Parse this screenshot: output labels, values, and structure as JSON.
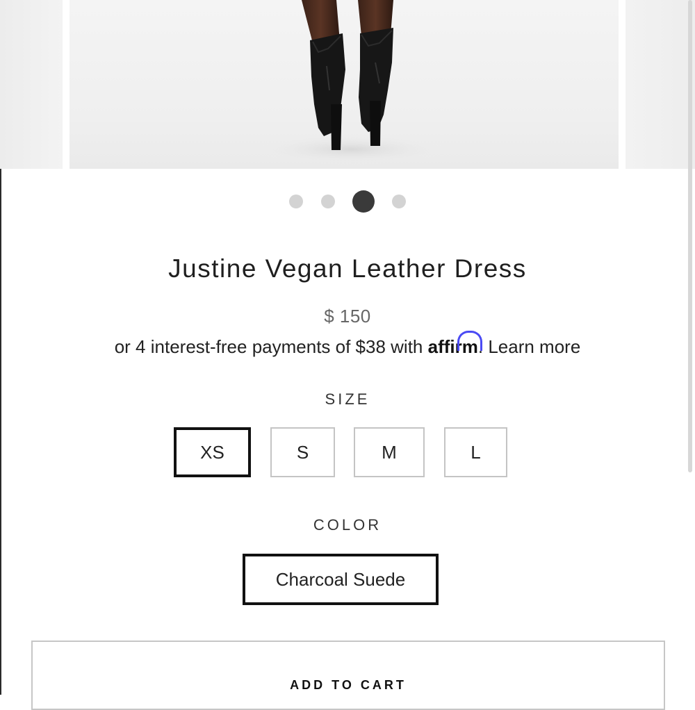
{
  "product": {
    "title": "Justine Vegan Leather Dress",
    "price": "$ 150",
    "financing": {
      "prefix": "or 4 interest-free payments of $38 with",
      "provider_logo": "affirm",
      "learn_more": ". Learn more"
    }
  },
  "gallery": {
    "image_count": 4,
    "active_index": 2
  },
  "size": {
    "label": "SIZE",
    "options": [
      "XS",
      "S",
      "M",
      "L"
    ],
    "selected": "XS"
  },
  "color": {
    "label": "COLOR",
    "selected": "Charcoal Suede"
  },
  "actions": {
    "add_to_cart": "ADD TO CART"
  },
  "colors": {
    "accent": "#111111",
    "affirm_blue": "#4a4af4",
    "inactive_dot": "#d3d3d3",
    "active_dot": "#3a3a3a"
  }
}
